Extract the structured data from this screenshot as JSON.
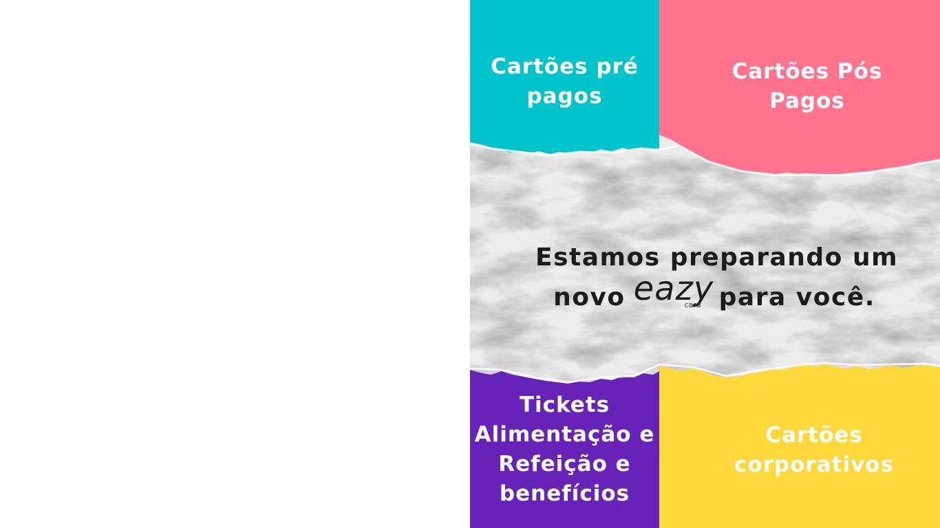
{
  "colors": {
    "teal": "#00C4CC",
    "pink": "#FF748C",
    "purple": "#6723B7",
    "yellow": "#FFD83C",
    "paper": "#ECECEC",
    "text_dark": "#1C1C1C"
  },
  "tiles": {
    "pre_pagos": "Cartões pré pagos",
    "pos_pagos": "Cartões Pós Pagos",
    "tickets": "Tickets Alimentação e Refeição e benefícios",
    "corporativos": "Cartões corporativos"
  },
  "headline": {
    "line1": "Estamos preparando um",
    "line2_before": "novo",
    "line2_after": "para você."
  },
  "logo": {
    "word": "eazy",
    "sub": "card"
  }
}
